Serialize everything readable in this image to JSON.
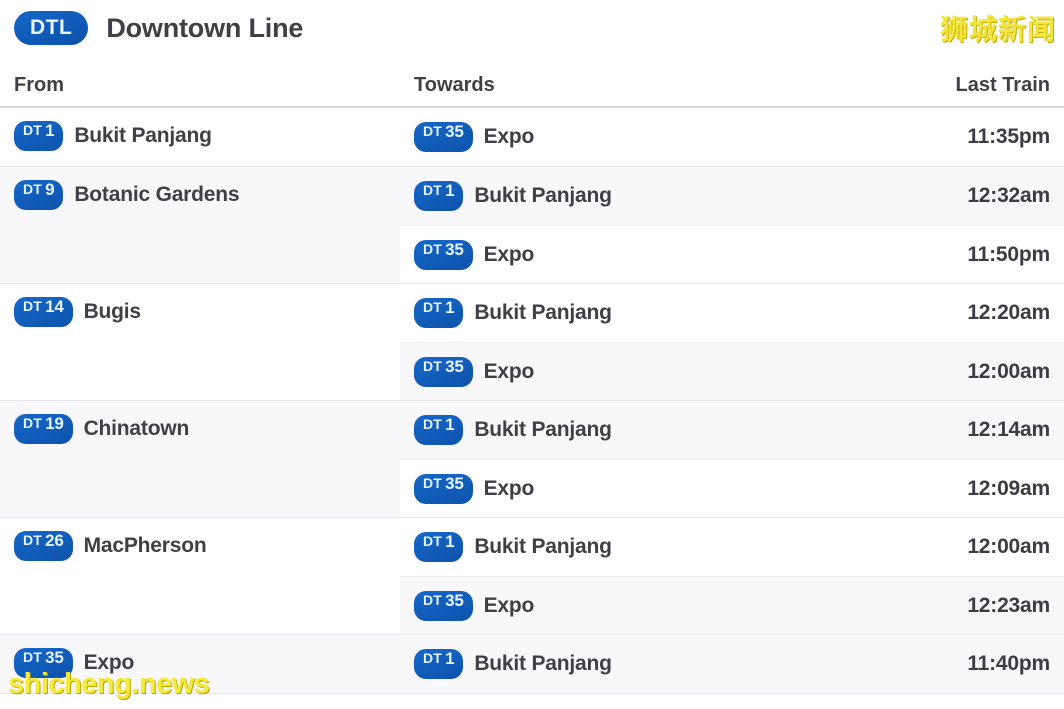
{
  "header": {
    "line_code": "DTL",
    "line_name": "Downtown Line",
    "accent_color": "#0f59b6"
  },
  "columns": {
    "from": "From",
    "towards": "Towards",
    "last_train": "Last Train"
  },
  "watermarks": {
    "top_right": "狮城新闻",
    "bottom_left": "shicheng.news",
    "color": "#f2e63c"
  },
  "groups": [
    {
      "from": {
        "prefix": "DT",
        "number": "1",
        "name": "Bukit Panjang"
      },
      "trips": [
        {
          "prefix": "DT",
          "number": "35",
          "name": "Expo",
          "last_train": "11:35pm"
        }
      ]
    },
    {
      "from": {
        "prefix": "DT",
        "number": "9",
        "name": "Botanic Gardens"
      },
      "trips": [
        {
          "prefix": "DT",
          "number": "1",
          "name": "Bukit Panjang",
          "last_train": "12:32am"
        },
        {
          "prefix": "DT",
          "number": "35",
          "name": "Expo",
          "last_train": "11:50pm"
        }
      ]
    },
    {
      "from": {
        "prefix": "DT",
        "number": "14",
        "name": "Bugis"
      },
      "trips": [
        {
          "prefix": "DT",
          "number": "1",
          "name": "Bukit Panjang",
          "last_train": "12:20am"
        },
        {
          "prefix": "DT",
          "number": "35",
          "name": "Expo",
          "last_train": "12:00am"
        }
      ]
    },
    {
      "from": {
        "prefix": "DT",
        "number": "19",
        "name": "Chinatown"
      },
      "trips": [
        {
          "prefix": "DT",
          "number": "1",
          "name": "Bukit Panjang",
          "last_train": "12:14am"
        },
        {
          "prefix": "DT",
          "number": "35",
          "name": "Expo",
          "last_train": "12:09am"
        }
      ]
    },
    {
      "from": {
        "prefix": "DT",
        "number": "26",
        "name": "MacPherson"
      },
      "trips": [
        {
          "prefix": "DT",
          "number": "1",
          "name": "Bukit Panjang",
          "last_train": "12:00am"
        },
        {
          "prefix": "DT",
          "number": "35",
          "name": "Expo",
          "last_train": "12:23am"
        }
      ]
    },
    {
      "from": {
        "prefix": "DT",
        "number": "35",
        "name": "Expo"
      },
      "trips": [
        {
          "prefix": "DT",
          "number": "1",
          "name": "Bukit Panjang",
          "last_train": "11:40pm"
        }
      ]
    }
  ]
}
